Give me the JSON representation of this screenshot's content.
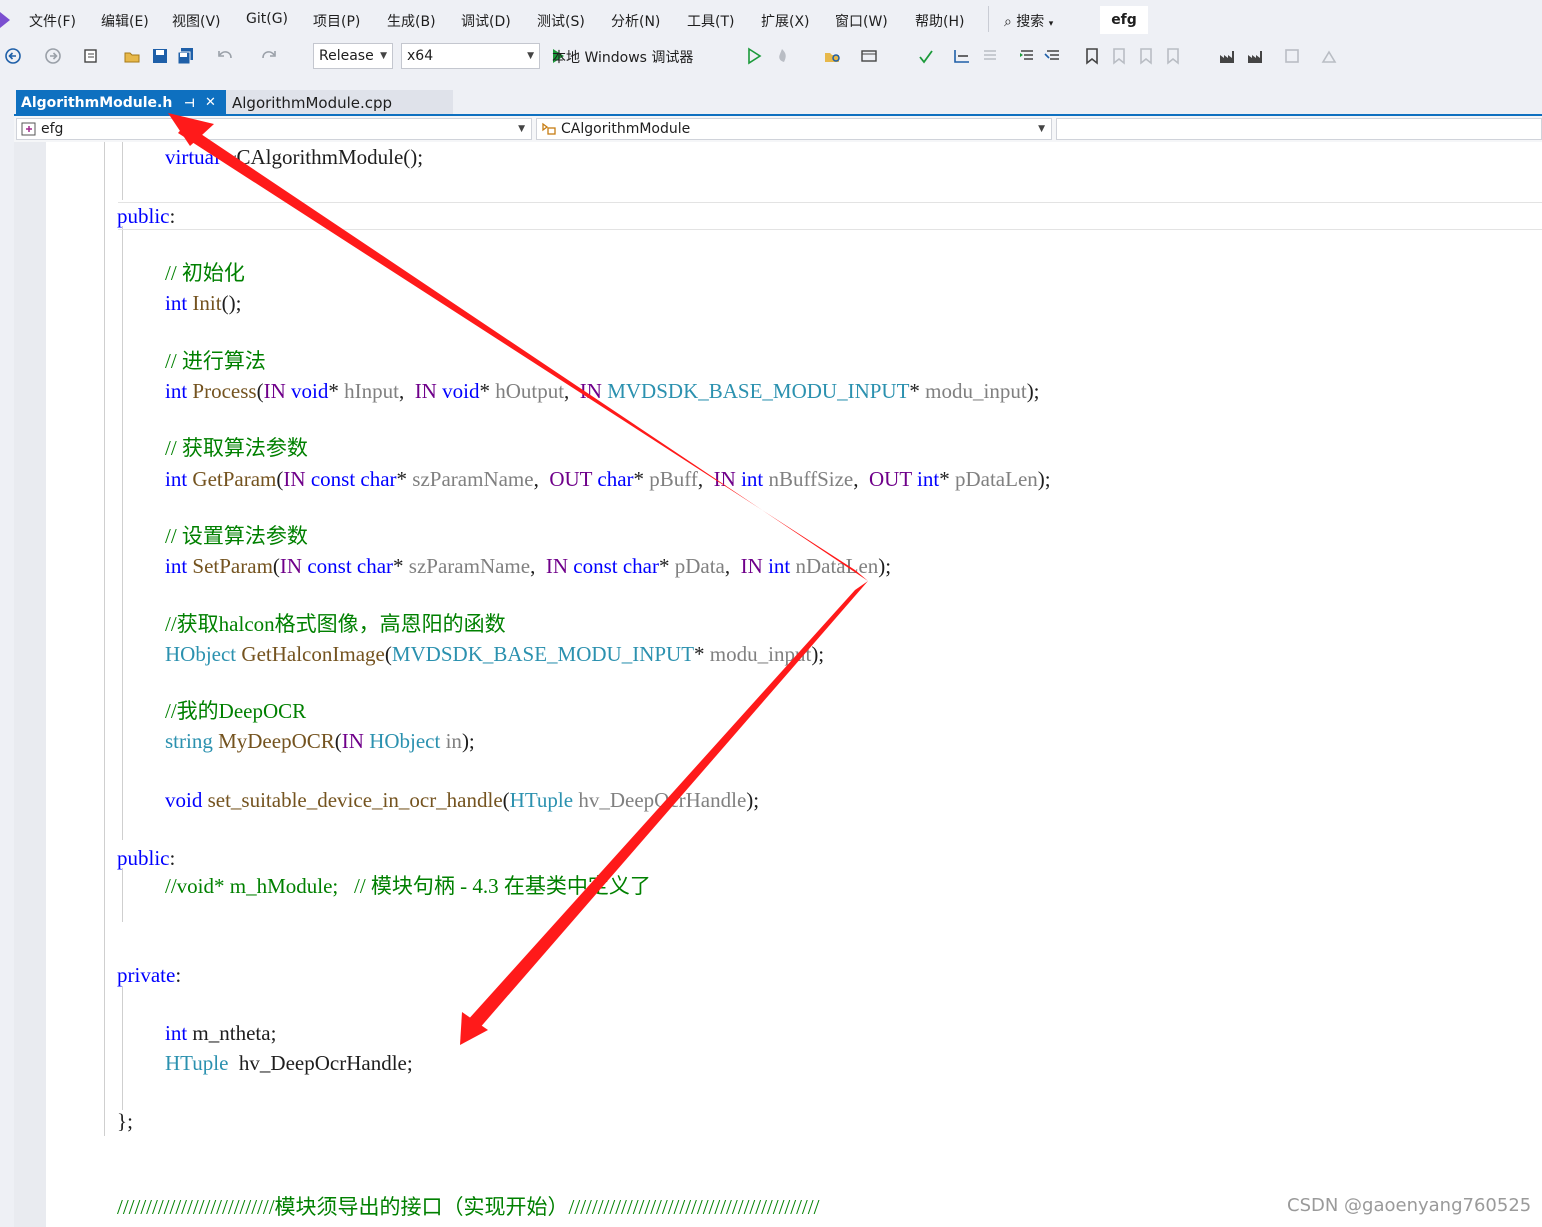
{
  "menu": {
    "items": [
      "文件(F)",
      "编辑(E)",
      "视图(V)",
      "Git(G)",
      "项目(P)",
      "生成(B)",
      "调试(D)",
      "测试(S)",
      "分析(N)",
      "工具(T)",
      "扩展(X)",
      "窗口(W)",
      "帮助(H)"
    ],
    "search_label": "搜索",
    "solution_name": "efg"
  },
  "toolbar": {
    "configuration": "Release",
    "platform": "x64",
    "run_label": "本地 Windows 调试器",
    "icons": [
      "back-icon",
      "forward-icon",
      "new-project-icon",
      "open-icon",
      "save-icon",
      "save-all-icon",
      "undo-icon",
      "redo-icon",
      "run-icon",
      "run-without-debug-icon",
      "hot-reload-icon",
      "find-files-icon",
      "bookmark-icon",
      "build-icon"
    ]
  },
  "tabs": [
    {
      "label": "AlgorithmModule.h",
      "active": true,
      "pin": "⊣",
      "close": "✕"
    },
    {
      "label": "AlgorithmModule.cpp",
      "active": false
    }
  ],
  "navbar": {
    "project": "efg",
    "scope": "CAlgorithmModule"
  },
  "code": {
    "l01": {
      "a": "virtual",
      "b": " ~CAlgorithmModule();"
    },
    "l02": {
      "a": "public",
      "b": ":"
    },
    "l03": {
      "a": "// 初始化"
    },
    "l04": {
      "a": "int",
      "b": " Init",
      "c": "();"
    },
    "l05": {
      "a": "// 进行算法"
    },
    "l06": {
      "t1": "int",
      "f": " Process",
      "p0": "(",
      "m1": "IN",
      "sp1": " ",
      "k1": "void",
      "r1": "* ",
      "v1": "hInput",
      "c1": ",  ",
      "m2": "IN",
      "sp2": " ",
      "k2": "void",
      "r2": "* ",
      "v2": "hOutput",
      "c2": ",  ",
      "m3": "IN",
      "sp3": " ",
      "ty": "MVDSDK_BASE_MODU_INPUT",
      "r3": "* ",
      "v3": "modu_input",
      "end": ");"
    },
    "l07": {
      "a": "// 获取算法参数"
    },
    "l08": {
      "t1": "int",
      "f": " GetParam",
      "p0": "(",
      "m1": "IN",
      "sp1": " ",
      "k1": "const",
      "sp1b": " ",
      "k1b": "char",
      "r1": "* ",
      "v1": "szParamName",
      "c1": ",  ",
      "m2": "OUT",
      "sp2": " ",
      "k2": "char",
      "r2": "* ",
      "v2": "pBuff",
      "c2": ",  ",
      "m3": "IN",
      "sp3": " ",
      "k3": "int",
      "sp3b": " ",
      "v3": "nBuffSize",
      "c3": ",  ",
      "m4": "OUT",
      "sp4": " ",
      "k4": "int",
      "r4": "* ",
      "v4": "pDataLen",
      "end": ");"
    },
    "l09": {
      "a": "// 设置算法参数"
    },
    "l10": {
      "t1": "int",
      "f": " SetParam",
      "p0": "(",
      "m1": "IN",
      "sp1": " ",
      "k1": "const",
      "sp1b": " ",
      "k1b": "char",
      "r1": "* ",
      "v1": "szParamName",
      "c1": ",  ",
      "m2": "IN",
      "sp2": " ",
      "k2": "const",
      "sp2b": " ",
      "k2b": "char",
      "r2": "* ",
      "v2": "pData",
      "c2": ",  ",
      "m3": "IN",
      "sp3": " ",
      "k3": "int",
      "sp3b": " ",
      "v3": "nDataLen",
      "end": ");"
    },
    "l11": {
      "a": "//获取halcon格式图像，高恩阳的函数"
    },
    "l12": {
      "ty": "HObject",
      "f": " GetHalconImage",
      "p0": "(",
      "ty2": "MVDSDK_BASE_MODU_INPUT",
      "r1": "* ",
      "v1": "modu_input",
      "end": ");"
    },
    "l13": {
      "a": "//我的DeepOCR"
    },
    "l14": {
      "ty": "string",
      "f": " MyDeepOCR",
      "p0": "(",
      "m1": "IN",
      "sp1": " ",
      "ty2": "HObject",
      "sp2": " ",
      "v1": "in",
      "end": ");"
    },
    "l15": {
      "k": "void",
      "f": " set_suitable_device_in_ocr_handle",
      "p0": "(",
      "ty": "HTuple",
      "sp": " ",
      "v": "hv_DeepOcrHandle",
      "end": ");"
    },
    "l16": {
      "a": "public",
      "b": ":"
    },
    "l17": {
      "a": "//void* m_hModule;   // 模块句柄 - 4.3 在基类中定义了"
    },
    "l18": {
      "a": "private",
      "b": ":"
    },
    "l19": {
      "a": "int",
      "b": " m_ntheta;"
    },
    "l20": {
      "a": "HTuple",
      "b": "  hv_DeepOcrHandle;"
    },
    "l21": {
      "a": "};"
    },
    "l22": {
      "a": "///////////////////////////模块须导出的接口（实现开始）///////////////////////////////////////////"
    }
  },
  "watermark": "CSDN @gaoenyang760525",
  "colors": {
    "accent": "#0e70c0",
    "keyword": "#0000ff",
    "type": "#2b91af",
    "macro": "#6f008a",
    "comment": "#008000",
    "arrow": "#ff1a1a"
  }
}
